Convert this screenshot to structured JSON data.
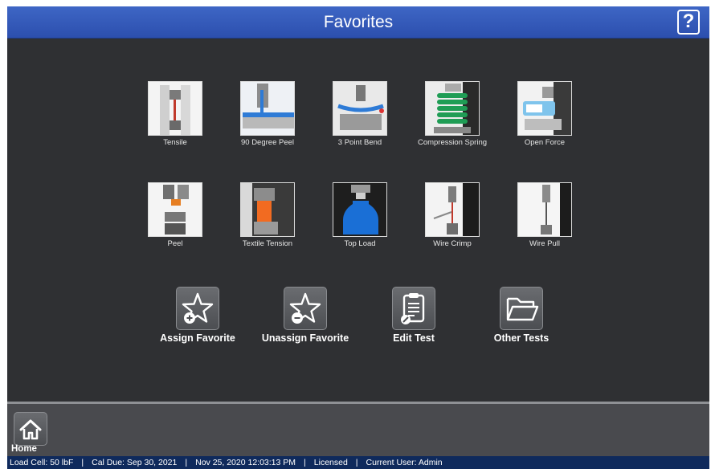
{
  "header": {
    "title": "Favorites",
    "help_label": "?"
  },
  "tests": [
    {
      "label": "Tensile",
      "icon": "tensile-test-image"
    },
    {
      "label": "90 Degree Peel",
      "icon": "peel-90-test-image"
    },
    {
      "label": "3 Point Bend",
      "icon": "three-point-bend-image"
    },
    {
      "label": "Compression Spring",
      "icon": "compression-spring-image"
    },
    {
      "label": "Open Force",
      "icon": "open-force-image"
    },
    {
      "label": "Peel",
      "icon": "peel-test-image"
    },
    {
      "label": "Textile Tension",
      "icon": "textile-tension-image"
    },
    {
      "label": "Top Load",
      "icon": "top-load-image"
    },
    {
      "label": "Wire Crimp",
      "icon": "wire-crimp-image"
    },
    {
      "label": "Wire Pull",
      "icon": "wire-pull-image"
    }
  ],
  "actions": {
    "assign": "Assign Favorite",
    "unassign": "Unassign Favorite",
    "edit": "Edit Test",
    "other": "Other Tests"
  },
  "footer": {
    "home_label": "Home"
  },
  "status": {
    "load_cell": "Load Cell: 50 lbF",
    "cal_due": "Cal Due: Sep 30, 2021",
    "datetime": "Nov 25, 2020 12:03:13 PM",
    "license": "Licensed",
    "user": "Current User: Admin",
    "separator": "|"
  },
  "colors": {
    "header_blue": "#3e66c5",
    "panel": "#2f3033",
    "status_bar": "#0f2a5c"
  }
}
